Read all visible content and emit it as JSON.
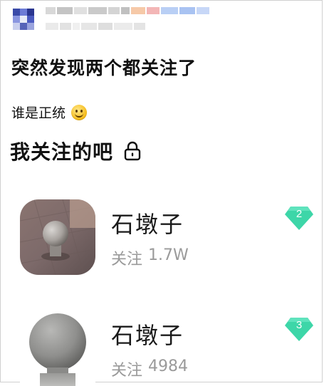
{
  "post": {
    "title": "突然发现两个都关注了",
    "text": "谁是正统",
    "emoji": "smile-emoji"
  },
  "section": {
    "title": "我关注的吧",
    "icon": "lock-icon"
  },
  "followed": [
    {
      "name": "石墩子",
      "follow_label": "关注",
      "follow_count": "1.7W",
      "level": "2",
      "badge_color": "#3dd6a8"
    },
    {
      "name": "石墩子",
      "follow_label": "关注",
      "follow_count": "4984",
      "level": "3",
      "badge_color": "#3dd6a8"
    }
  ],
  "colors": {
    "text_primary": "#111111",
    "text_secondary": "#9a9a9a",
    "badge": "#3dd6a8"
  }
}
